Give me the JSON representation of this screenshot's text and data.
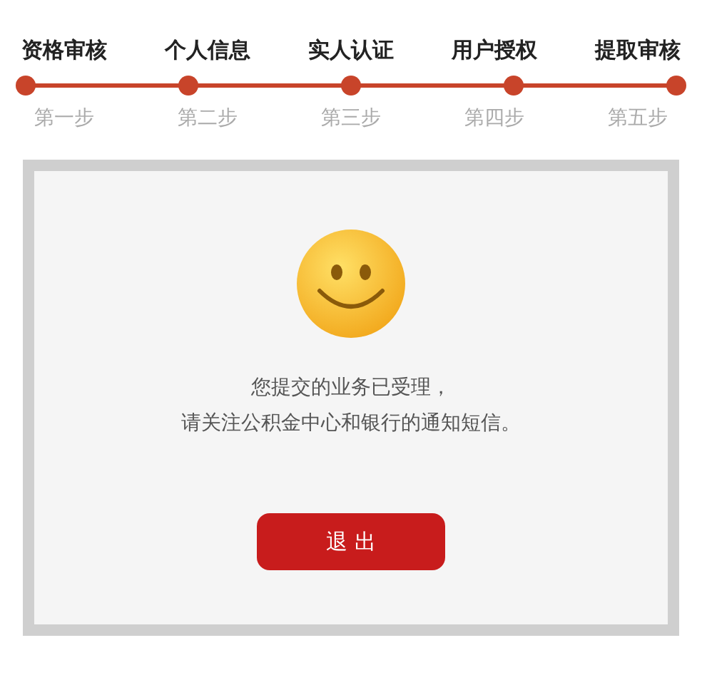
{
  "steps": [
    {
      "title": "资格审核",
      "label": "第一步"
    },
    {
      "title": "个人信息",
      "label": "第二步"
    },
    {
      "title": "实人认证",
      "label": "第三步"
    },
    {
      "title": "用户授权",
      "label": "第四步"
    },
    {
      "title": "提取审核",
      "label": "第五步"
    }
  ],
  "result": {
    "message_lines": [
      "您提交的业务已受理，",
      "请关注公积金中心和银行的通知短信。"
    ],
    "button": "退 出"
  }
}
